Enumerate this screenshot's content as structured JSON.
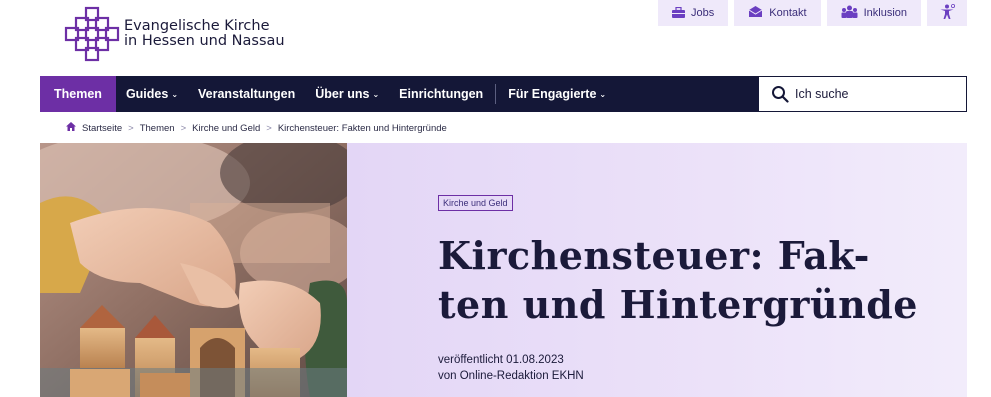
{
  "brand": {
    "line1": "Evangelische Kirche",
    "line2": "in Hessen und Nassau",
    "logo_icon": "cross-logo-icon",
    "color": "#6d2fa5"
  },
  "utility_nav": {
    "jobs": "Jobs",
    "kontakt": "Kontakt",
    "inklusion": "Inklusion",
    "accessibility_icon": "accessibility-icon"
  },
  "main_nav": {
    "themen": "Themen",
    "guides": "Guides",
    "veranstaltungen": "Veranstaltungen",
    "ueber_uns": "Über uns",
    "einrichtungen": "Einrichtungen",
    "fuer_engagierte": "Für Engagierte",
    "active": "Themen"
  },
  "search": {
    "placeholder": "Ich suche"
  },
  "breadcrumb": {
    "home": "Startseite",
    "level1": "Themen",
    "level2": "Kirche und Geld",
    "current": "Kirchensteuer: Fakten und Hintergründe"
  },
  "hero": {
    "tag": "Kirche und Geld",
    "title_line1": "Kirchensteuer: Fak-",
    "title_line2": "ten und Hintergründe",
    "published": "veröffentlicht 01.08.2023",
    "author": "von Online-Redaktion EKHN"
  },
  "colors": {
    "navbar": "#141737",
    "active_tab": "#6d2fa5",
    "hero_bg": "#e3d6f6",
    "utility_bg": "#efe9fa"
  }
}
